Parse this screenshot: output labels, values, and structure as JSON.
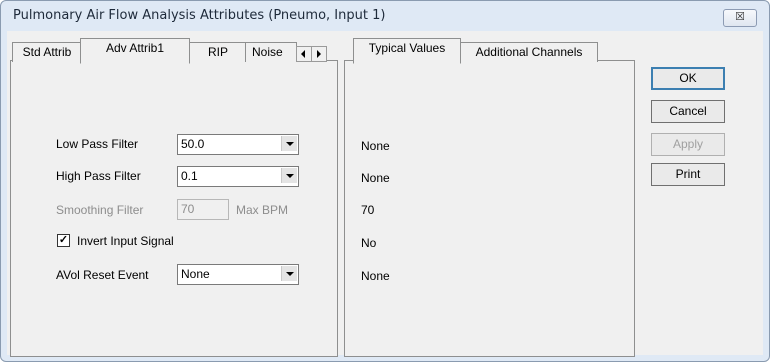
{
  "window": {
    "title": "Pulmonary Air Flow Analysis Attributes  (Pneumo, Input 1)",
    "close_glyph": "☒"
  },
  "left_tabs": [
    "Std Attrib",
    "Adv Attrib1",
    "RIP",
    "Noise"
  ],
  "right_tabs": [
    "Typical Values",
    "Additional Channels"
  ],
  "form": {
    "low_pass": {
      "label": "Low Pass Filter",
      "value": "50.0"
    },
    "high_pass": {
      "label": "High Pass Filter",
      "value": "0.1"
    },
    "smoothing": {
      "label": "Smoothing Filter",
      "value": "70",
      "unit": "Max BPM"
    },
    "invert": {
      "label": "Invert Input Signal",
      "checked": true,
      "mark": "✓"
    },
    "avol": {
      "label": "AVol Reset Event",
      "value": "None"
    }
  },
  "typical_values": [
    "None",
    "None",
    "70",
    "No",
    "None"
  ],
  "buttons": {
    "ok": "OK",
    "cancel": "Cancel",
    "apply": "Apply",
    "print": "Print"
  }
}
